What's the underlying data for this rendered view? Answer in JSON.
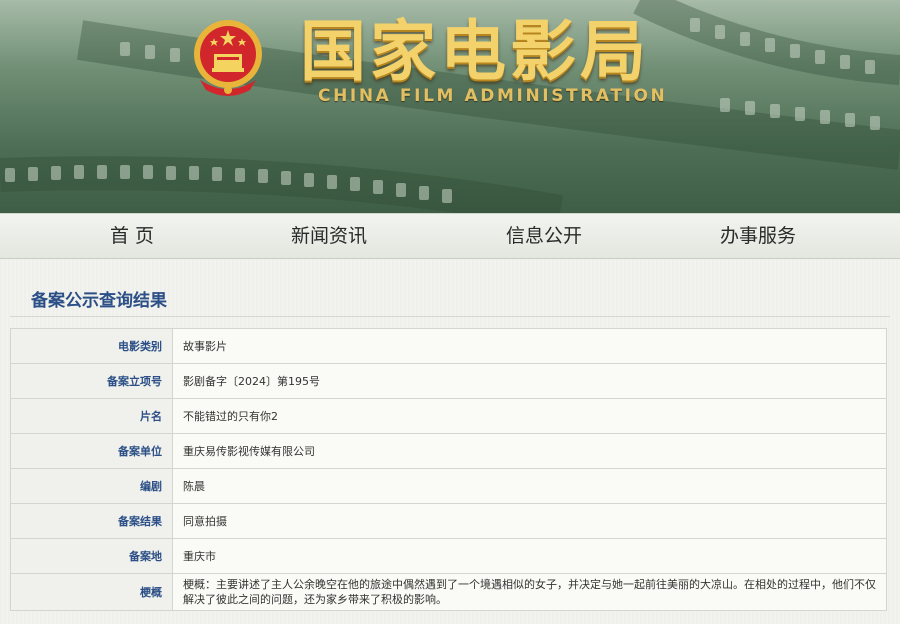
{
  "header": {
    "title_cn": "国家电影局",
    "title_en": "CHINA FILM ADMINISTRATION",
    "emblem_icon": "national-emblem-icon"
  },
  "nav": {
    "items": [
      {
        "label": "首 页"
      },
      {
        "label": "新闻资讯"
      },
      {
        "label": "信息公开"
      },
      {
        "label": "办事服务"
      }
    ]
  },
  "section": {
    "title": "备案公示查询结果"
  },
  "records": [
    {
      "label": "电影类别",
      "value": "故事影片"
    },
    {
      "label": "备案立项号",
      "value": "影剧备字〔2024〕第195号"
    },
    {
      "label": "片名",
      "value": "不能错过的只有你2"
    },
    {
      "label": "备案单位",
      "value": "重庆易传影视传媒有限公司"
    },
    {
      "label": "编剧",
      "value": "陈晨"
    },
    {
      "label": "备案结果",
      "value": "同意拍摄"
    },
    {
      "label": "备案地",
      "value": "重庆市"
    },
    {
      "label": "梗概",
      "value": "梗概：主要讲述了主人公余晚空在他的旅途中偶然遇到了一个境遇相似的女子，并决定与她一起前往美丽的大凉山。在相处的过程中，他们不仅解决了彼此之间的问题，还为家乡带来了积极的影响。"
    }
  ],
  "colors": {
    "banner_green": "#4d6d54",
    "title_gold": "#f3d16b",
    "label_blue": "#2b4f86"
  }
}
